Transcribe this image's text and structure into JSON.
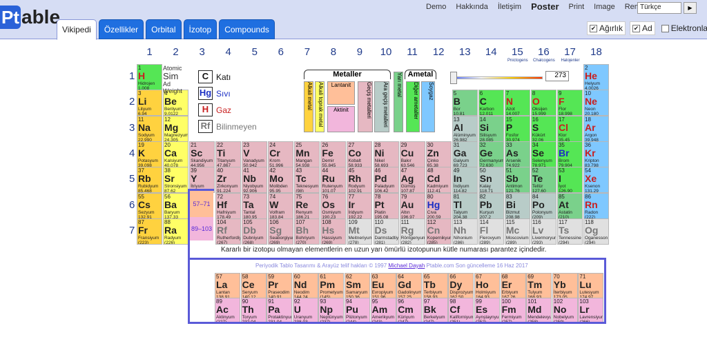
{
  "app": {
    "logo_pt": "Pt",
    "logo_rest": "able"
  },
  "toplinks": [
    "Demo",
    "Hakkında",
    "İletişim",
    "Poster",
    "Print",
    "Image",
    "Remove ads"
  ],
  "language": {
    "selected": "Türkçe",
    "go": "▶"
  },
  "tabs": [
    "Vikipedi",
    "Özellikler",
    "Orbital",
    "İzotop",
    "Compounds"
  ],
  "checks": [
    {
      "label": "Ağırlık",
      "checked": true
    },
    {
      "label": "Ad",
      "checked": true
    },
    {
      "label": "Elektronlar",
      "checked": false
    }
  ],
  "groups": [
    "1",
    "2",
    "3",
    "4",
    "5",
    "6",
    "7",
    "8",
    "9",
    "10",
    "11",
    "12",
    "13",
    "14",
    "15",
    "16",
    "17",
    "18"
  ],
  "group_subs": {
    "15": "Pnictogens",
    "16": "Chalcogens",
    "17": "Halojenler"
  },
  "periods": [
    "1",
    "2",
    "3",
    "4",
    "5",
    "6",
    "7"
  ],
  "key": {
    "atomic": "Atomic",
    "sym": "Sim",
    "ad": "Ad",
    "weight": "Weight"
  },
  "states": [
    {
      "sym": "C",
      "label": "Katı",
      "color": "#111"
    },
    {
      "sym": "Hg",
      "label": "Sıvı",
      "color": "#1b2fc4"
    },
    {
      "sym": "H",
      "label": "Gaz",
      "color": "#c81e1e"
    },
    {
      "sym": "Rf",
      "label": "Bilinmeyen",
      "color": "#777"
    }
  ],
  "cats": {
    "metaller": "Metaller",
    "ametal": "Ametal",
    "lantanit": "Lantanit",
    "aktinit": "Aktinit",
    "alkali": "Alkali metal",
    "toprak": "Alkali toprak metal",
    "gecis": "Geçiş metalleri",
    "yarimetal": "Yarı metal",
    "gecissonrasi": "Ara geçiş metalleri",
    "diger": "Diğer ametaller",
    "soy": "Soygaz"
  },
  "temperature": "273",
  "lanth_range": "57–71",
  "act_range": "89–103",
  "note": "Kararlı bir izotopu olmayan elementlerin en uzun yarı ömürlü izotopunun kütle numarası parantez içindedir.",
  "credit": "Periyodik Tablo Tasarımı & Arayüz telif hakları © 1997",
  "credit_author": "Michael Dayah",
  "credit_tail": "Ptable.com Son güncelleme 16 Haz 2017",
  "colors": {
    "alkali": "#ffd23f",
    "alkaline": "#ffff66",
    "trans": "#e6b8c2",
    "post": "#b8ccc8",
    "metalloid": "#7ad18b",
    "nonmetal": "#55e655",
    "halogen": "#b0f0ff",
    "noble": "#7fc8ff",
    "lanth": "#ffbf99",
    "act": "#f2b6dc",
    "unknown": "#e0e0e0"
  },
  "elements": [
    [
      "1",
      "H",
      "Hidrojen",
      "1.008",
      1,
      1,
      "nonmetal",
      "gas"
    ],
    [
      "2",
      "He",
      "Helyum",
      "4.0026",
      18,
      1,
      "noble",
      "gas"
    ],
    [
      "3",
      "Li",
      "Lityum",
      "6.94",
      1,
      2,
      "alkali",
      ""
    ],
    [
      "4",
      "Be",
      "Berilyum",
      "9.0122",
      2,
      2,
      "alkaline",
      ""
    ],
    [
      "5",
      "B",
      "Bor",
      "10.81",
      13,
      2,
      "metalloid",
      ""
    ],
    [
      "6",
      "C",
      "Karbon",
      "12.011",
      14,
      2,
      "nonmetal",
      ""
    ],
    [
      "7",
      "N",
      "Azot",
      "14.007",
      15,
      2,
      "nonmetal",
      "gas"
    ],
    [
      "8",
      "O",
      "Oksijen",
      "15.999",
      16,
      2,
      "nonmetal",
      "gas"
    ],
    [
      "9",
      "F",
      "Flor",
      "18.998",
      17,
      2,
      "nonmetal",
      "gas"
    ],
    [
      "10",
      "Ne",
      "Neon",
      "20.180",
      18,
      2,
      "noble",
      "gas"
    ],
    [
      "11",
      "Na",
      "Sodyum",
      "22.990",
      1,
      3,
      "alkali",
      ""
    ],
    [
      "12",
      "Mg",
      "Magnezyum",
      "24.305",
      2,
      3,
      "alkaline",
      ""
    ],
    [
      "13",
      "Al",
      "Alüminyum",
      "26.982",
      13,
      3,
      "post",
      ""
    ],
    [
      "14",
      "Si",
      "Silisyum",
      "28.085",
      14,
      3,
      "metalloid",
      ""
    ],
    [
      "15",
      "P",
      "Fosfor",
      "30.974",
      15,
      3,
      "nonmetal",
      ""
    ],
    [
      "16",
      "S",
      "Kükürt",
      "32.06",
      16,
      3,
      "nonmetal",
      ""
    ],
    [
      "17",
      "Cl",
      "Klor",
      "35.45",
      17,
      3,
      "nonmetal",
      "gas"
    ],
    [
      "18",
      "Ar",
      "Argon",
      "39.948",
      18,
      3,
      "noble",
      "gas"
    ],
    [
      "19",
      "K",
      "Potasyum",
      "39.098",
      1,
      4,
      "alkali",
      ""
    ],
    [
      "20",
      "Ca",
      "Kalsiyum",
      "40.078",
      2,
      4,
      "alkaline",
      ""
    ],
    [
      "21",
      "Sc",
      "Skandiyum",
      "44.956",
      3,
      4,
      "trans",
      ""
    ],
    [
      "22",
      "Ti",
      "Titanyum",
      "47.867",
      4,
      4,
      "trans",
      ""
    ],
    [
      "23",
      "V",
      "Vanadyum",
      "50.942",
      5,
      4,
      "trans",
      ""
    ],
    [
      "24",
      "Cr",
      "Krom",
      "51.996",
      6,
      4,
      "trans",
      ""
    ],
    [
      "25",
      "Mn",
      "Mangan",
      "54.938",
      7,
      4,
      "trans",
      ""
    ],
    [
      "26",
      "Fe",
      "Demir",
      "55.845",
      8,
      4,
      "trans",
      ""
    ],
    [
      "27",
      "Co",
      "Kobalt",
      "58.933",
      9,
      4,
      "trans",
      ""
    ],
    [
      "28",
      "Ni",
      "Nikel",
      "58.693",
      10,
      4,
      "trans",
      ""
    ],
    [
      "29",
      "Cu",
      "Bakır",
      "63.546",
      11,
      4,
      "trans",
      ""
    ],
    [
      "30",
      "Zn",
      "Çinko",
      "65.38",
      12,
      4,
      "trans",
      ""
    ],
    [
      "31",
      "Ga",
      "Galyum",
      "69.723",
      13,
      4,
      "post",
      ""
    ],
    [
      "32",
      "Ge",
      "Germanyum",
      "72.630",
      14,
      4,
      "metalloid",
      ""
    ],
    [
      "33",
      "As",
      "Arsenik",
      "74.922",
      15,
      4,
      "metalloid",
      ""
    ],
    [
      "34",
      "Se",
      "Selenyum",
      "78.971",
      16,
      4,
      "nonmetal",
      ""
    ],
    [
      "35",
      "Br",
      "Brom",
      "79.904",
      17,
      4,
      "nonmetal",
      "liquid"
    ],
    [
      "36",
      "Kr",
      "Kripton",
      "83.798",
      18,
      4,
      "noble",
      "gas"
    ],
    [
      "37",
      "Rb",
      "Rubidyum",
      "85.468",
      1,
      5,
      "alkali",
      ""
    ],
    [
      "38",
      "Sr",
      "Stronsiyum",
      "87.62",
      2,
      5,
      "alkaline",
      ""
    ],
    [
      "39",
      "Y",
      "İtriyum",
      "88.906",
      3,
      5,
      "trans",
      ""
    ],
    [
      "40",
      "Zr",
      "Zirkonyum",
      "91.224",
      4,
      5,
      "trans",
      ""
    ],
    [
      "41",
      "Nb",
      "Niyobyum",
      "92.906",
      5,
      5,
      "trans",
      ""
    ],
    [
      "42",
      "Mo",
      "Molibden",
      "95.95",
      6,
      5,
      "trans",
      ""
    ],
    [
      "43",
      "Tc",
      "Teknesyum",
      "(98)",
      7,
      5,
      "trans",
      ""
    ],
    [
      "44",
      "Ru",
      "Rutenyum",
      "101.07",
      8,
      5,
      "trans",
      ""
    ],
    [
      "45",
      "Rh",
      "Rodyum",
      "102.91",
      9,
      5,
      "trans",
      ""
    ],
    [
      "46",
      "Pd",
      "Paladyum",
      "106.42",
      10,
      5,
      "trans",
      ""
    ],
    [
      "47",
      "Ag",
      "Gümüş",
      "107.87",
      11,
      5,
      "trans",
      ""
    ],
    [
      "48",
      "Cd",
      "Kadmiyum",
      "112.41",
      12,
      5,
      "trans",
      ""
    ],
    [
      "49",
      "In",
      "İndiyum",
      "114.82",
      13,
      5,
      "post",
      ""
    ],
    [
      "50",
      "Sn",
      "Kalay",
      "118.71",
      14,
      5,
      "post",
      ""
    ],
    [
      "51",
      "Sb",
      "Antimon",
      "121.76",
      15,
      5,
      "metalloid",
      ""
    ],
    [
      "52",
      "Te",
      "Tellür",
      "127.60",
      16,
      5,
      "metalloid",
      ""
    ],
    [
      "53",
      "I",
      "İyot",
      "126.90",
      17,
      5,
      "nonmetal",
      ""
    ],
    [
      "54",
      "Xe",
      "Ksenon",
      "131.29",
      18,
      5,
      "noble",
      "gas"
    ],
    [
      "55",
      "Cs",
      "Sezyum",
      "132.91",
      1,
      6,
      "alkali",
      ""
    ],
    [
      "56",
      "Ba",
      "Baryum",
      "137.33",
      2,
      6,
      "alkaline",
      ""
    ],
    [
      "72",
      "Hf",
      "Hafniyum",
      "178.49",
      4,
      6,
      "trans",
      ""
    ],
    [
      "73",
      "Ta",
      "Tantal",
      "180.95",
      5,
      6,
      "trans",
      ""
    ],
    [
      "74",
      "W",
      "Volfram",
      "183.84",
      6,
      6,
      "trans",
      ""
    ],
    [
      "75",
      "Re",
      "Renyum",
      "186.21",
      7,
      6,
      "trans",
      ""
    ],
    [
      "76",
      "Os",
      "Osmiyum",
      "190.23",
      8,
      6,
      "trans",
      ""
    ],
    [
      "77",
      "Ir",
      "İridyum",
      "192.22",
      9,
      6,
      "trans",
      ""
    ],
    [
      "78",
      "Pt",
      "Platin",
      "195.08",
      10,
      6,
      "trans",
      ""
    ],
    [
      "79",
      "Au",
      "Altın",
      "196.97",
      11,
      6,
      "trans",
      ""
    ],
    [
      "80",
      "Hg",
      "Cıva",
      "200.59",
      12,
      6,
      "trans",
      "liquid"
    ],
    [
      "81",
      "Tl",
      "Talyum",
      "204.38",
      13,
      6,
      "post",
      ""
    ],
    [
      "82",
      "Pb",
      "Kurşun",
      "207.2",
      14,
      6,
      "post",
      ""
    ],
    [
      "83",
      "Bi",
      "Bizmut",
      "208.98",
      15,
      6,
      "post",
      ""
    ],
    [
      "84",
      "Po",
      "Polonyum",
      "(209)",
      16,
      6,
      "post",
      ""
    ],
    [
      "85",
      "At",
      "Astatin",
      "(210)",
      17,
      6,
      "metalloid",
      ""
    ],
    [
      "86",
      "Rn",
      "Radon",
      "(222)",
      18,
      6,
      "noble",
      "gas"
    ],
    [
      "87",
      "Fr",
      "Fransiyum",
      "(223)",
      1,
      7,
      "alkali",
      ""
    ],
    [
      "88",
      "Ra",
      "Radyum",
      "(226)",
      2,
      7,
      "alkaline",
      ""
    ],
    [
      "104",
      "Rf",
      "Rutherfordiy",
      "(267)",
      4,
      7,
      "trans",
      "unknown"
    ],
    [
      "105",
      "Db",
      "Dubniyum",
      "(268)",
      5,
      7,
      "trans",
      "unknown"
    ],
    [
      "106",
      "Sg",
      "Seaborgiyum",
      "(269)",
      6,
      7,
      "trans",
      "unknown"
    ],
    [
      "107",
      "Bh",
      "Bohriyum",
      "(270)",
      7,
      7,
      "trans",
      "unknown"
    ],
    [
      "108",
      "Hs",
      "Hassiyum",
      "(269)",
      8,
      7,
      "trans",
      "unknown"
    ],
    [
      "109",
      "Mt",
      "Meitneriyum",
      "(278)",
      9,
      7,
      "unknown",
      "unknown"
    ],
    [
      "110",
      "Ds",
      "Darmstadtiyum",
      "(281)",
      10,
      7,
      "unknown",
      "unknown"
    ],
    [
      "111",
      "Rg",
      "Röntgenyum",
      "(282)",
      11,
      7,
      "unknown",
      "unknown"
    ],
    [
      "112",
      "Cn",
      "Kopernikyum",
      "(285)",
      12,
      7,
      "trans",
      "unknown"
    ],
    [
      "113",
      "Nh",
      "Nihonium",
      "(286)",
      13,
      7,
      "unknown",
      "unknown"
    ],
    [
      "114",
      "Fl",
      "Flerovyum",
      "(289)",
      14,
      7,
      "unknown",
      "unknown"
    ],
    [
      "115",
      "Mc",
      "Moscovium",
      "(289)",
      15,
      7,
      "unknown",
      "unknown"
    ],
    [
      "116",
      "Lv",
      "Livermoryum",
      "(293)",
      16,
      7,
      "unknown",
      "unknown"
    ],
    [
      "117",
      "Ts",
      "Tennessine",
      "(294)",
      17,
      7,
      "unknown",
      "unknown"
    ],
    [
      "118",
      "Og",
      "Oganesson",
      "(294)",
      18,
      7,
      "unknown",
      "unknown"
    ]
  ],
  "lanthanides": [
    [
      "57",
      "La",
      "Lantan",
      "138.91"
    ],
    [
      "58",
      "Ce",
      "Seryum",
      "140.12"
    ],
    [
      "59",
      "Pr",
      "Praseodim",
      "140.91"
    ],
    [
      "60",
      "Nd",
      "Neodim",
      "144.24"
    ],
    [
      "61",
      "Pm",
      "Prometyum",
      "(145)"
    ],
    [
      "62",
      "Sm",
      "Samaryum",
      "150.36"
    ],
    [
      "63",
      "Eu",
      "Evropiyum",
      "151.96"
    ],
    [
      "64",
      "Gd",
      "Gadolinyum",
      "157.25"
    ],
    [
      "65",
      "Tb",
      "Terbiyum",
      "158.93"
    ],
    [
      "66",
      "Dy",
      "Disprozyum",
      "162.50"
    ],
    [
      "67",
      "Ho",
      "Holmiyum",
      "164.93"
    ],
    [
      "68",
      "Er",
      "Erbiyum",
      "167.26"
    ],
    [
      "69",
      "Tm",
      "Tulyum",
      "168.93"
    ],
    [
      "70",
      "Yb",
      "İterbiyum",
      "173.05"
    ],
    [
      "71",
      "Lu",
      "Lutesyum",
      "174.97"
    ]
  ],
  "actinides": [
    [
      "89",
      "Ac",
      "Aktinyum",
      "(227)"
    ],
    [
      "90",
      "Th",
      "Toryum",
      "232.04"
    ],
    [
      "91",
      "Pa",
      "Protaktinyum",
      "231.04"
    ],
    [
      "92",
      "U",
      "Uranyum",
      "238.03"
    ],
    [
      "93",
      "Np",
      "Neptünyum",
      "(237)"
    ],
    [
      "94",
      "Pu",
      "Plütonyum",
      "(244)"
    ],
    [
      "95",
      "Am",
      "Amerikyum",
      "(243)"
    ],
    [
      "96",
      "Cm",
      "Küriyum",
      "(247)"
    ],
    [
      "97",
      "Bk",
      "Berkelyum",
      "(247)"
    ],
    [
      "98",
      "Cf",
      "Kaliforniyum",
      "(251)"
    ],
    [
      "99",
      "Es",
      "Aynştaynyum",
      "(252)"
    ],
    [
      "100",
      "Fm",
      "Fermiyum",
      "(257)"
    ],
    [
      "101",
      "Md",
      "Mendelevyum",
      "(258)"
    ],
    [
      "102",
      "No",
      "Nobelyum",
      "(259)"
    ],
    [
      "103",
      "Lr",
      "Lavrensiyum",
      "(266)"
    ]
  ]
}
